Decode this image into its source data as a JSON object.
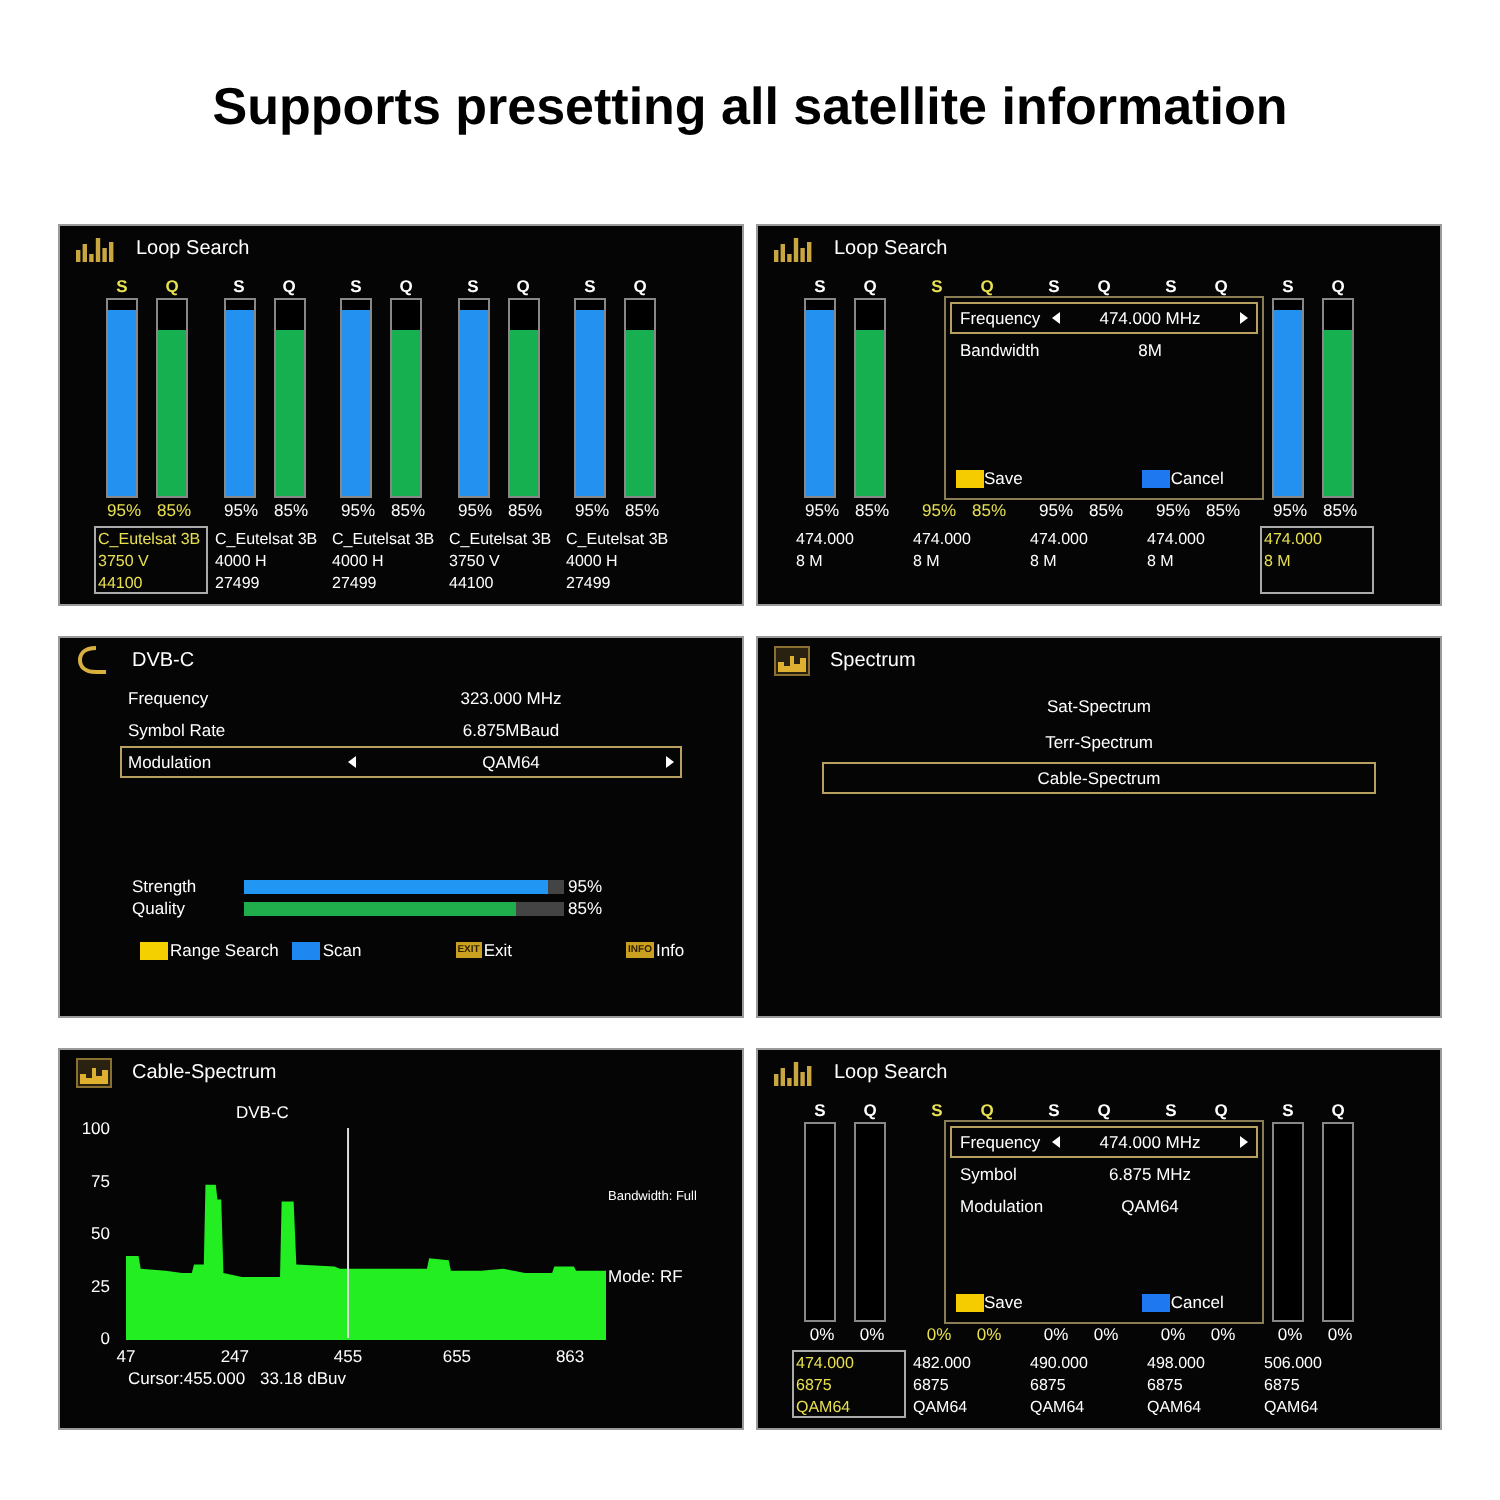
{
  "headline": "Supports presetting all satellite information",
  "panels": [
    {
      "kind": "loop_search",
      "title": "Loop Search",
      "channels": [
        {
          "s_label": "S",
          "q_label": "Q",
          "s_meter": {
            "level": 0.95
          },
          "q_meter": {
            "level": 0.85
          },
          "s_reading": "95%",
          "q_reading": "85%",
          "lines": [
            "C_Eutelsat 3B",
            "3750 V",
            "44100"
          ],
          "highlighted": true,
          "selected": true
        },
        {
          "s_label": "S",
          "q_label": "Q",
          "s_meter": {
            "level": 0.95
          },
          "q_meter": {
            "level": 0.85
          },
          "s_reading": "95%",
          "q_reading": "85%",
          "lines": [
            "C_Eutelsat 3B",
            "4000 H",
            "27499"
          ],
          "highlighted": false,
          "selected": false
        },
        {
          "s_label": "S",
          "q_label": "Q",
          "s_meter": {
            "level": 0.95
          },
          "q_meter": {
            "level": 0.85
          },
          "s_reading": "95%",
          "q_reading": "85%",
          "lines": [
            "C_Eutelsat 3B",
            "4000 H",
            "27499"
          ],
          "highlighted": false,
          "selected": false
        },
        {
          "s_label": "S",
          "q_label": "Q",
          "s_meter": {
            "level": 0.95
          },
          "q_meter": {
            "level": 0.85
          },
          "s_reading": "95%",
          "q_reading": "85%",
          "lines": [
            "C_Eutelsat 3B",
            "3750 V",
            "44100"
          ],
          "highlighted": false,
          "selected": false
        },
        {
          "s_label": "S",
          "q_label": "Q",
          "s_meter": {
            "level": 0.95
          },
          "q_meter": {
            "level": 0.85
          },
          "s_reading": "95%",
          "q_reading": "85%",
          "lines": [
            "C_Eutelsat 3B",
            "4000 H",
            "27499"
          ],
          "highlighted": false,
          "selected": false
        }
      ]
    },
    {
      "kind": "loop_search",
      "title": "Loop Search",
      "channels": [
        {
          "s_label": "S",
          "q_label": "Q",
          "s_meter": {
            "level": 0.95
          },
          "q_meter": {
            "level": 0.85
          },
          "s_reading": "95%",
          "q_reading": "85%",
          "lines": [
            "474.000",
            "8 M"
          ],
          "highlighted": false,
          "selected": false
        },
        {
          "s_label": "S",
          "q_label": "Q",
          "s_reading": "95%",
          "q_reading": "85%",
          "lines": [
            "474.000",
            "8 M"
          ],
          "highlighted": true,
          "selected": false
        },
        {
          "s_label": "S",
          "q_label": "Q",
          "s_reading": "95%",
          "q_reading": "85%",
          "lines": [
            "474.000",
            "8 M"
          ],
          "highlighted": false,
          "selected": false
        },
        {
          "s_label": "S",
          "q_label": "Q",
          "s_reading": "95%",
          "q_reading": "85%",
          "lines": [
            "474.000",
            "8 M"
          ],
          "highlighted": false,
          "selected": false
        },
        {
          "s_label": "S",
          "q_label": "Q",
          "s_meter": {
            "level": 0.95
          },
          "q_meter": {
            "level": 0.85
          },
          "s_reading": "95%",
          "q_reading": "85%",
          "lines": [
            "474.000",
            "8 M"
          ],
          "highlighted": false,
          "selected": true
        }
      ],
      "dialog": {
        "rows": [
          {
            "label": "Frequency",
            "value": "474.000 MHz",
            "focused": true
          },
          {
            "label": "Bandwidth",
            "value": "8M",
            "focused": false
          }
        ],
        "buttons": [
          {
            "label": "Save",
            "color": "#f5cc00"
          },
          {
            "label": "Cancel",
            "color": "#1e78f0"
          }
        ]
      }
    },
    {
      "kind": "dvb",
      "title": "DVB-C",
      "rows": [
        {
          "label": "Frequency",
          "value": "323.000 MHz",
          "focused": false
        },
        {
          "label": "Symbol Rate",
          "value": "6.875MBaud",
          "focused": false
        },
        {
          "label": "Modulation",
          "value": "QAM64",
          "focused": true
        }
      ],
      "meters": [
        {
          "label": "Strength",
          "level": 0.95,
          "reading": "95%",
          "color": "#2196f3"
        },
        {
          "label": "Quality",
          "level": 0.85,
          "reading": "85%",
          "color": "#1fae4b"
        }
      ],
      "legend": [
        {
          "kind": "swatch",
          "color": "#f5d000",
          "label": "Range Search"
        },
        {
          "kind": "swatch",
          "color": "#1e88f0",
          "label": "Scan"
        },
        {
          "kind": "key",
          "key": "EXIT",
          "label": "Exit"
        },
        {
          "kind": "key",
          "key": "INFO",
          "label": "Info"
        }
      ]
    },
    {
      "kind": "menu",
      "title": "Spectrum",
      "items": [
        {
          "label": "Sat-Spectrum",
          "selected": false
        },
        {
          "label": "Terr-Spectrum",
          "selected": false
        },
        {
          "label": "Cable-Spectrum",
          "selected": true
        }
      ]
    },
    {
      "kind": "spectrum",
      "title": "Cable-Spectrum",
      "standard": "DVB-C",
      "side_labels": [
        "Bandwidth: Full",
        "Mode: RF"
      ],
      "cursor": "Cursor:455.000",
      "reading": "33.18 dBuv",
      "chart_data": {
        "type": "area",
        "xlim": [
          47,
          929
        ],
        "ylim": [
          0,
          100
        ],
        "xticks": [
          47,
          247,
          455,
          655,
          863
        ],
        "yticks": [
          0,
          25,
          50,
          75,
          100
        ],
        "x": [
          47,
          70,
          74,
          120,
          150,
          168,
          172,
          190,
          193,
          212,
          215,
          222,
          226,
          260,
          330,
          333,
          355,
          360,
          430,
          440,
          520,
          600,
          604,
          640,
          644,
          700,
          740,
          780,
          830,
          834,
          870,
          874,
          929
        ],
        "series": [
          {
            "color": "#22ee22",
            "values": [
              39,
              39,
              33,
              32,
              31,
              31,
              35,
              35,
              73,
              73,
              66,
              66,
              31,
              29,
              29,
              65,
              65,
              35,
              34,
              33,
              33,
              33,
              38,
              37,
              32,
              32,
              33,
              31,
              31,
              34,
              34,
              32,
              32
            ]
          }
        ],
        "ref_lines": [
          {
            "axis": "x",
            "value": 455
          }
        ]
      }
    },
    {
      "kind": "loop_search",
      "title": "Loop Search",
      "channels": [
        {
          "s_label": "S",
          "q_label": "Q",
          "s_meter": {
            "level": 0
          },
          "q_meter": {
            "level": 0
          },
          "s_reading": "0%",
          "q_reading": "0%",
          "lines": [
            "474.000",
            "6875",
            "QAM64"
          ],
          "highlighted": false,
          "selected": true
        },
        {
          "s_label": "S",
          "q_label": "Q",
          "s_reading": "0%",
          "q_reading": "0%",
          "lines": [
            "482.000",
            "6875",
            "QAM64"
          ],
          "highlighted": true,
          "selected": false
        },
        {
          "s_label": "S",
          "q_label": "Q",
          "s_reading": "0%",
          "q_reading": "0%",
          "lines": [
            "490.000",
            "6875",
            "QAM64"
          ],
          "highlighted": false,
          "selected": false
        },
        {
          "s_label": "S",
          "q_label": "Q",
          "s_reading": "0%",
          "q_reading": "0%",
          "lines": [
            "498.000",
            "6875",
            "QAM64"
          ],
          "highlighted": false,
          "selected": false
        },
        {
          "s_label": "S",
          "q_label": "Q",
          "s_meter": {
            "level": 0
          },
          "q_meter": {
            "level": 0
          },
          "s_reading": "0%",
          "q_reading": "0%",
          "lines": [
            "506.000",
            "6875",
            "QAM64"
          ],
          "highlighted": false,
          "selected": false
        }
      ],
      "dialog": {
        "rows": [
          {
            "label": "Frequency",
            "value": "474.000 MHz",
            "focused": true
          },
          {
            "label": "Symbol",
            "value": "6.875 MHz",
            "focused": false
          },
          {
            "label": "Modulation",
            "value": "QAM64",
            "focused": false
          }
        ],
        "buttons": [
          {
            "label": "Save",
            "color": "#f5cc00"
          },
          {
            "label": "Cancel",
            "color": "#1e78f0"
          }
        ]
      }
    }
  ]
}
